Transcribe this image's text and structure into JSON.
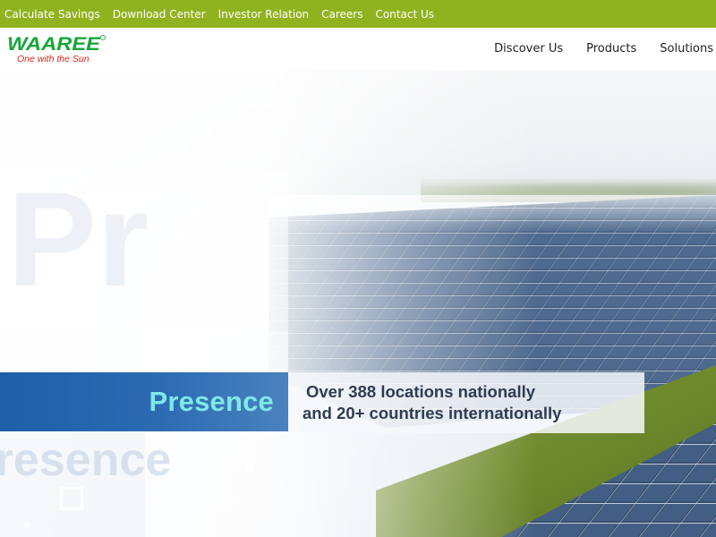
{
  "topbar": {
    "links": [
      "Calculate Savings",
      "Download Center",
      "Investor Relation",
      "Careers",
      "Contact Us"
    ]
  },
  "header": {
    "logo_text": "WAAREE",
    "tagline": "One with the Sun",
    "nav": [
      "Discover Us",
      "Products",
      "Solutions"
    ]
  },
  "hero": {
    "label": "Presence",
    "line1": "Over 388 locations nationally",
    "line2": "and 20+ countries internationally",
    "ghost_text": "Presence"
  },
  "colors": {
    "topbar_bg": "#8fb31f",
    "brand_green": "#16a637",
    "brand_red": "#d8261c",
    "band_blue": "#1f5ea8",
    "presence_text": "#7ee8e8"
  }
}
